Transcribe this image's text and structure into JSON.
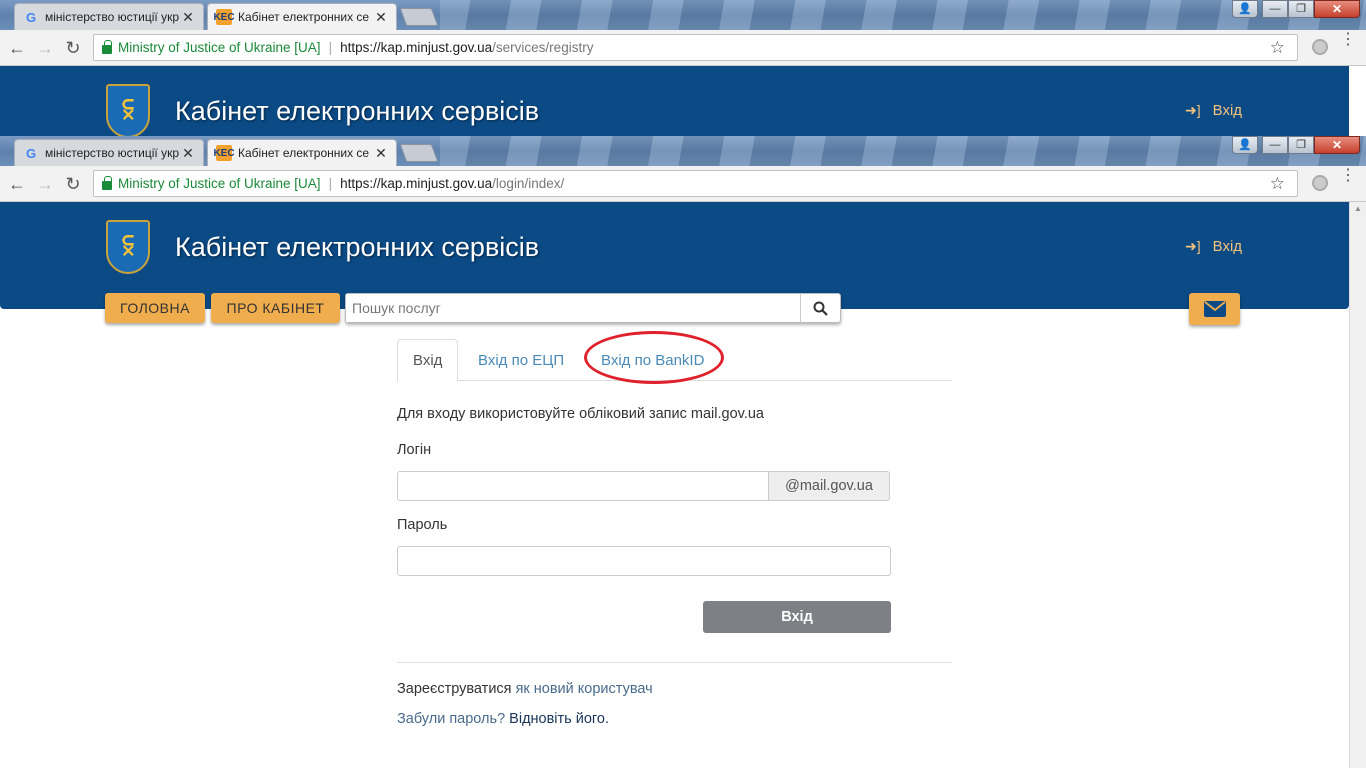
{
  "windows": [
    {
      "tabs": [
        {
          "title": "міністерство юстиції укр",
          "active": false
        },
        {
          "title": "Кабінет електронних се",
          "active": true
        }
      ],
      "address": {
        "org": "Ministry of Justice of Ukraine [UA]",
        "host": "https://kap.minjust.gov.ua",
        "path": "/services/registry"
      }
    },
    {
      "tabs": [
        {
          "title": "міністерство юстиції укр",
          "active": false
        },
        {
          "title": "Кабінет електронних се",
          "active": true
        }
      ],
      "address": {
        "org": "Ministry of Justice of Ukraine [UA]",
        "host": "https://kap.minjust.gov.ua",
        "path": "/login/index/"
      }
    }
  ],
  "site": {
    "title": "Кабінет електронних сервісів",
    "login_link": "Вхід",
    "crest_glyph": "⫁",
    "nav": {
      "home": "ГОЛОВНА",
      "about": "ПРО КАБІНЕТ"
    },
    "search_placeholder": "Пошук послуг"
  },
  "login": {
    "tabs": [
      "Вхід",
      "Вхід по ЕЦП",
      "Вхід по BankID"
    ],
    "active_tab": 0,
    "info": "Для входу використовуйте обліковий запис mail.gov.ua",
    "login_label": "Логін",
    "login_value": "",
    "domain_suffix": "@mail.gov.ua",
    "password_label": "Пароль",
    "password_value": "",
    "submit": "Вхід",
    "register_prefix": "Зареєструватися",
    "register_link": "як новий користувач",
    "forgot_prefix": "Забули пароль?",
    "forgot_link": "Відновіть його."
  },
  "highlight_color": "#e0202a",
  "brand_color": "#0b4a85",
  "accent_color": "#f0ad4e"
}
